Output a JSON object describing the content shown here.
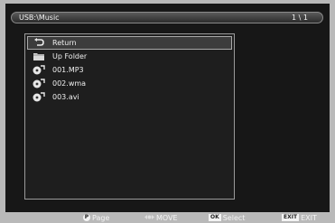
{
  "header": {
    "path": "USB:\\Music",
    "page": "1 \\ 1"
  },
  "items": [
    {
      "label": "Return",
      "icon": "return-arrow-icon",
      "selected": true
    },
    {
      "label": "Up Folder",
      "icon": "folder-icon"
    },
    {
      "label": "001.MP3",
      "icon": "media-file-icon"
    },
    {
      "label": "002.wma",
      "icon": "media-file-icon"
    },
    {
      "label": "003.avi",
      "icon": "media-file-icon"
    }
  ],
  "legend": {
    "page": {
      "key": "P",
      "label": "Page"
    },
    "move": {
      "key": "",
      "label": "MOVE"
    },
    "select": {
      "key": "OK",
      "label": "Select"
    },
    "exit": {
      "key": "EXIT",
      "label": "EXIT"
    }
  }
}
